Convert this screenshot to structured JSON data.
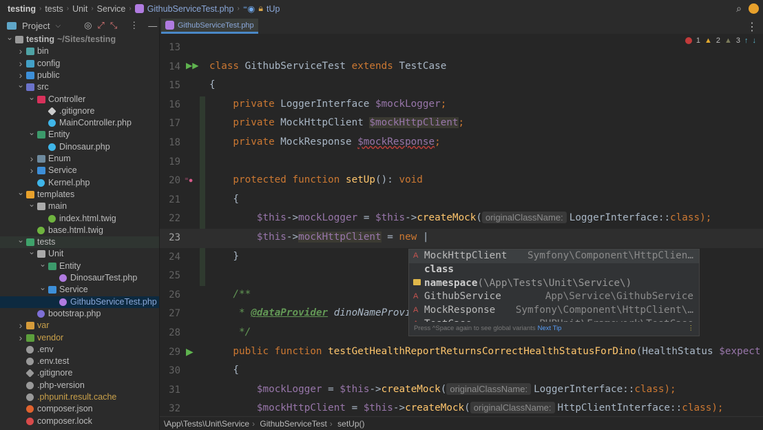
{
  "nav": {
    "crumbs": [
      "testing",
      "tests",
      "Unit",
      "Service"
    ],
    "file": "GithubServiceTest.php",
    "method": "tUp"
  },
  "sidebar": {
    "title": "Project",
    "items": [
      {
        "label": "testing",
        "suffix": "~/Sites/testing",
        "level": 0,
        "arrow": "open",
        "icon": "folder",
        "color": "#999999"
      },
      {
        "label": "bin",
        "level": 1,
        "arrow": "closed",
        "icon": "folder",
        "color": "#4fa3a5"
      },
      {
        "label": "config",
        "level": 1,
        "arrow": "closed",
        "icon": "folder",
        "color": "#43a0c6"
      },
      {
        "label": "public",
        "level": 1,
        "arrow": "closed",
        "icon": "folder",
        "color": "#3d8fd8"
      },
      {
        "label": "src",
        "level": 1,
        "arrow": "open",
        "icon": "folder",
        "color": "#6b72c9"
      },
      {
        "label": "Controller",
        "level": 2,
        "arrow": "open",
        "icon": "folder",
        "color": "#d8315b"
      },
      {
        "label": ".gitignore",
        "level": 3,
        "arrow": "none",
        "icon": "git",
        "color": "#cccccc"
      },
      {
        "label": "MainController.php",
        "level": 3,
        "arrow": "none",
        "icon": "file",
        "color": "#3fb5e8"
      },
      {
        "label": "Entity",
        "level": 2,
        "arrow": "open",
        "icon": "folder",
        "color": "#3c9a6b"
      },
      {
        "label": "Dinosaur.php",
        "level": 3,
        "arrow": "none",
        "icon": "file",
        "color": "#3fb5e8"
      },
      {
        "label": "Enum",
        "level": 2,
        "arrow": "closed",
        "icon": "folder",
        "color": "#6e8a9e"
      },
      {
        "label": "Service",
        "level": 2,
        "arrow": "closed",
        "icon": "folder",
        "color": "#3d8fd8"
      },
      {
        "label": "Kernel.php",
        "level": 2,
        "arrow": "none",
        "icon": "file",
        "color": "#3fb5e8"
      },
      {
        "label": "templates",
        "level": 1,
        "arrow": "open",
        "icon": "folder",
        "color": "#e8a12c"
      },
      {
        "label": "main",
        "level": 2,
        "arrow": "open",
        "icon": "folder",
        "color": "#aaaaaa"
      },
      {
        "label": "index.html.twig",
        "level": 3,
        "arrow": "none",
        "icon": "twig",
        "color": "#6fb43f"
      },
      {
        "label": "base.html.twig",
        "level": 2,
        "arrow": "none",
        "icon": "twig",
        "color": "#6fb43f"
      },
      {
        "label": "tests",
        "level": 1,
        "arrow": "open",
        "icon": "folder",
        "color": "#3fa36b",
        "state": "hl"
      },
      {
        "label": "Unit",
        "level": 2,
        "arrow": "open",
        "icon": "folder",
        "color": "#aaaaaa"
      },
      {
        "label": "Entity",
        "level": 3,
        "arrow": "open",
        "icon": "folder",
        "color": "#3c9a6b"
      },
      {
        "label": "DinosaurTest.php",
        "level": 4,
        "arrow": "none",
        "icon": "php",
        "color": "#b07be0"
      },
      {
        "label": "Service",
        "level": 3,
        "arrow": "open",
        "icon": "folder",
        "color": "#3d8fd8"
      },
      {
        "label": "GithubServiceTest.php",
        "level": 4,
        "arrow": "none",
        "icon": "php",
        "color": "#b07be0",
        "state": "sel"
      },
      {
        "label": "bootstrap.php",
        "level": 2,
        "arrow": "none",
        "icon": "php",
        "color": "#7e6fd6"
      },
      {
        "label": "var",
        "level": 1,
        "arrow": "closed",
        "icon": "folder",
        "color": "#d59b3a",
        "text": "#c9a04a"
      },
      {
        "label": "vendor",
        "level": 1,
        "arrow": "closed",
        "icon": "folder",
        "color": "#5c9e3c",
        "text": "#c9a04a"
      },
      {
        "label": ".env",
        "level": 1,
        "arrow": "none",
        "icon": "env",
        "color": "#999999"
      },
      {
        "label": ".env.test",
        "level": 1,
        "arrow": "none",
        "icon": "env",
        "color": "#999999"
      },
      {
        "label": ".gitignore",
        "level": 1,
        "arrow": "none",
        "icon": "git",
        "color": "#999999"
      },
      {
        "label": ".php-version",
        "level": 1,
        "arrow": "none",
        "icon": "doc",
        "color": "#999999"
      },
      {
        "label": ".phpunit.result.cache",
        "level": 1,
        "arrow": "none",
        "icon": "doc",
        "color": "#999999",
        "text": "#c9a04a"
      },
      {
        "label": "composer.json",
        "level": 1,
        "arrow": "none",
        "icon": "comp",
        "color": "#e0622e"
      },
      {
        "label": "composer.lock",
        "level": 1,
        "arrow": "none",
        "icon": "lock",
        "color": "#d84a4a"
      }
    ]
  },
  "tab": {
    "label": "GithubServiceTest.php"
  },
  "inspections": {
    "errors": "1",
    "warnings": "2",
    "weak": "3"
  },
  "editor": {
    "current_line": 23,
    "lines": [
      {
        "n": 13,
        "t": []
      },
      {
        "n": 14,
        "t": [
          [
            "class ",
            "kw"
          ],
          [
            "GithubServiceTest ",
            ""
          ],
          [
            "extends ",
            "kw"
          ],
          [
            "TestCase",
            ""
          ]
        ]
      },
      {
        "n": 15,
        "t": [
          [
            "{",
            ""
          ]
        ]
      },
      {
        "n": 16,
        "t": [
          [
            "    private ",
            "kw"
          ],
          [
            "LoggerInterface ",
            ""
          ],
          [
            "$mockLogger",
            "var"
          ],
          [
            ";",
            "kw"
          ]
        ]
      },
      {
        "n": 17,
        "t": [
          [
            "    private ",
            "kw"
          ],
          [
            "MockHttpClient ",
            ""
          ],
          [
            "$mockHttpClient",
            "var usage"
          ],
          [
            ";",
            "kw"
          ]
        ]
      },
      {
        "n": 18,
        "t": [
          [
            "    private ",
            "kw"
          ],
          [
            "MockResponse ",
            ""
          ],
          [
            "$mockResponse",
            "var squig"
          ],
          [
            ";",
            "kw"
          ]
        ]
      },
      {
        "n": 19,
        "t": []
      },
      {
        "n": 20,
        "t": [
          [
            "    protected function ",
            "kw"
          ],
          [
            "setUp",
            "fn"
          ],
          [
            "(): ",
            ""
          ],
          [
            "void",
            "kw"
          ]
        ]
      },
      {
        "n": 21,
        "t": [
          [
            "    {",
            ""
          ]
        ]
      },
      {
        "n": 22,
        "t": [
          [
            "        ",
            ""
          ],
          [
            "$this",
            "var"
          ],
          [
            "->",
            ""
          ],
          [
            "mockLogger",
            "var"
          ],
          [
            " = ",
            ""
          ],
          [
            "$this",
            "var"
          ],
          [
            "->",
            ""
          ],
          [
            "createMock",
            "fn"
          ],
          [
            "(",
            ""
          ],
          [
            "originalClassName:",
            "hint"
          ],
          [
            "LoggerInterface::",
            ""
          ],
          [
            "class",
            "kw"
          ],
          [
            ");",
            "kw"
          ]
        ]
      },
      {
        "n": 23,
        "t": [
          [
            "        ",
            ""
          ],
          [
            "$this",
            "var"
          ],
          [
            "->",
            ""
          ],
          [
            "mockHttpClient",
            "var usage"
          ],
          [
            " = ",
            ""
          ],
          [
            "new ",
            "kw"
          ],
          [
            "|",
            ""
          ]
        ]
      },
      {
        "n": 24,
        "t": [
          [
            "    }",
            ""
          ]
        ]
      },
      {
        "n": 25,
        "t": []
      },
      {
        "n": 26,
        "t": [
          [
            "    /**",
            "doc"
          ]
        ]
      },
      {
        "n": 27,
        "t": [
          [
            "     * ",
            "doc"
          ],
          [
            "@dataProvider",
            "doctag"
          ],
          [
            " dinoNameProvi",
            "docv"
          ]
        ]
      },
      {
        "n": 28,
        "t": [
          [
            "     */",
            "doc"
          ]
        ]
      },
      {
        "n": 29,
        "t": [
          [
            "    public function ",
            "kw"
          ],
          [
            "testGetHealthReportReturnsCorrectHealthStatusForDino",
            "fn"
          ],
          [
            "(HealthStatus ",
            ""
          ],
          [
            "$expect",
            "var"
          ]
        ]
      },
      {
        "n": 30,
        "t": [
          [
            "    {",
            ""
          ]
        ]
      },
      {
        "n": 31,
        "t": [
          [
            "        ",
            ""
          ],
          [
            "$mockLogger",
            "var"
          ],
          [
            " = ",
            ""
          ],
          [
            "$this",
            "var"
          ],
          [
            "->",
            ""
          ],
          [
            "createMock",
            "fn"
          ],
          [
            "(",
            ""
          ],
          [
            "originalClassName:",
            "hint"
          ],
          [
            "LoggerInterface::",
            ""
          ],
          [
            "class",
            "kw"
          ],
          [
            ");",
            "kw"
          ]
        ]
      },
      {
        "n": 32,
        "t": [
          [
            "        ",
            ""
          ],
          [
            "$mockHttpClient",
            "var"
          ],
          [
            " = ",
            ""
          ],
          [
            "$this",
            "var"
          ],
          [
            "->",
            ""
          ],
          [
            "createMock",
            "fn"
          ],
          [
            "(",
            ""
          ],
          [
            "originalClassName:",
            "hint"
          ],
          [
            "HttpClientInterface::",
            ""
          ],
          [
            "class",
            "kw"
          ],
          [
            ");",
            "kw"
          ]
        ]
      }
    ]
  },
  "completion": {
    "items": [
      {
        "type": "A",
        "name": "MockHttpClient",
        "detail": "Symfony\\Component\\HttpClien…"
      },
      {
        "type": "",
        "name": "class",
        "detail": "",
        "bold": true
      },
      {
        "type": "folder",
        "name": "namespace",
        "detail": "(\\App\\Tests\\Unit\\Service\\)",
        "bold": true
      },
      {
        "type": "A",
        "name": "GithubService",
        "detail": "App\\Service\\GithubService"
      },
      {
        "type": "A",
        "name": "MockResponse",
        "detail": "Symfony\\Component\\HttpClient\\…"
      },
      {
        "type": "A",
        "name": "TestCase",
        "detail": "PHPUnit\\Framework\\TestCase"
      }
    ],
    "footer": "Press ^Space again to see global variants",
    "next_tip": "Next Tip"
  },
  "status": {
    "crumbs": [
      "\\App\\Tests\\Unit\\Service",
      "GithubServiceTest",
      "setUp()"
    ]
  }
}
